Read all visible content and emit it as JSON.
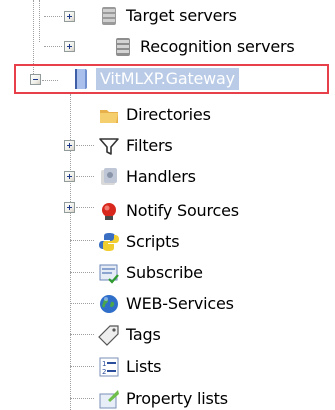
{
  "tree": {
    "nodes": [
      {
        "key": "target",
        "label": "Target servers",
        "icon": "server-icon",
        "expander": "plus"
      },
      {
        "key": "recognition",
        "label": "Recognition servers",
        "icon": "server-icon",
        "expander": "plus"
      },
      {
        "key": "gateway",
        "label": "VitMLXP.Gateway",
        "icon": "book-icon",
        "expander": "minus",
        "selected": true
      },
      {
        "key": "directories",
        "label": "Directories",
        "icon": "folder-icon",
        "expander": "plus"
      },
      {
        "key": "filters",
        "label": "Filters",
        "icon": "funnel-icon",
        "expander": "plus"
      },
      {
        "key": "handlers",
        "label": "Handlers",
        "icon": "handlers-icon",
        "expander": "plus"
      },
      {
        "key": "notify",
        "label": "Notify Sources",
        "icon": "alarm-icon",
        "expander": "none"
      },
      {
        "key": "scripts",
        "label": "Scripts",
        "icon": "python-icon",
        "expander": "none"
      },
      {
        "key": "subscribe",
        "label": "Subscribe",
        "icon": "subscribe-icon",
        "expander": "none"
      },
      {
        "key": "webservices",
        "label": "WEB-Services",
        "icon": "globe-icon",
        "expander": "none"
      },
      {
        "key": "tags",
        "label": "Tags",
        "icon": "tag-icon",
        "expander": "none"
      },
      {
        "key": "lists",
        "label": "Lists",
        "icon": "list-icon",
        "expander": "none"
      },
      {
        "key": "propertylists",
        "label": "Property lists",
        "icon": "property-list-icon",
        "expander": "none"
      }
    ]
  },
  "colors": {
    "selection_frame": "#e8404a",
    "selection_fill": "#b9cbe6",
    "connector": "#a0a0a0"
  }
}
